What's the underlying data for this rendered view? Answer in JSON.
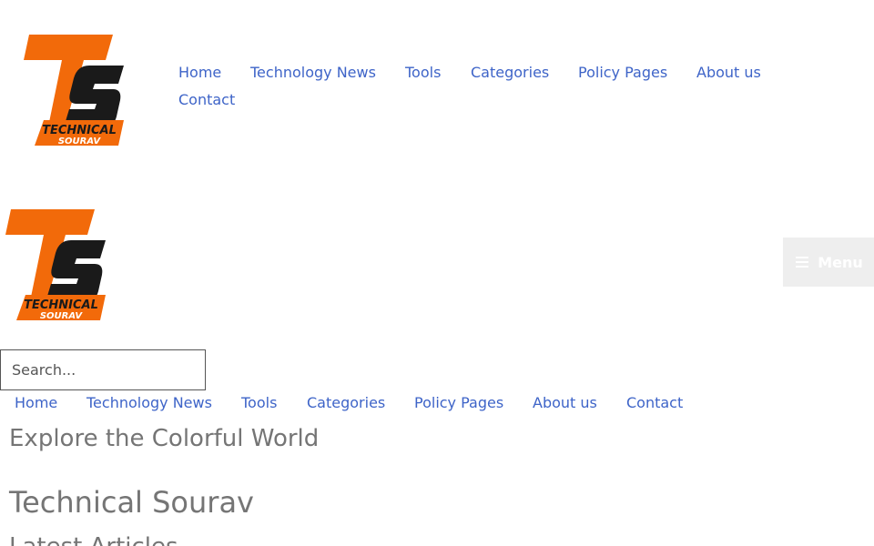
{
  "brand": {
    "logo_lines": [
      "TECHNICAL",
      "SOURAV"
    ],
    "logo_initials": "TS",
    "colors": {
      "orange": "#f26a0a",
      "dark": "#1a1a1a",
      "link": "#3e64c8"
    }
  },
  "header_nav": {
    "items": [
      "Home",
      "Technology News",
      "Tools",
      "Categories",
      "Policy Pages",
      "About us",
      "Contact"
    ]
  },
  "mobile_menu": {
    "label": "Menu",
    "icon": "hamburger-icon"
  },
  "search": {
    "placeholder": "Search..."
  },
  "secondary_nav": {
    "items": [
      "Home",
      "Technology News",
      "Tools",
      "Categories",
      "Policy Pages",
      "About us",
      "Contact"
    ]
  },
  "main": {
    "tagline": "Explore the Colorful World",
    "site_title": "Technical Sourav",
    "section_title": "Latest Articles"
  }
}
